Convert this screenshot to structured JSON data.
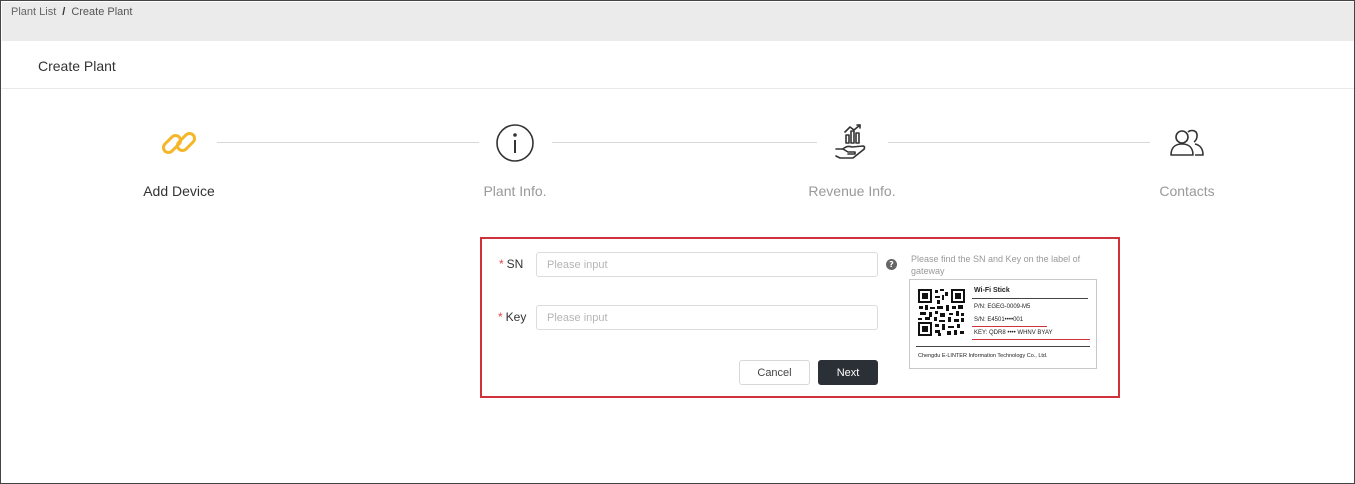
{
  "breadcrumb": {
    "items": [
      "Plant List",
      "Create Plant"
    ],
    "separator": "/"
  },
  "page": {
    "title": "Create Plant"
  },
  "steps": [
    {
      "label": "Add Device",
      "icon": "link-icon",
      "state": "active"
    },
    {
      "label": "Plant Info.",
      "icon": "info-icon",
      "state": "inactive"
    },
    {
      "label": "Revenue Info.",
      "icon": "revenue-hand-icon",
      "state": "inactive"
    },
    {
      "label": "Contacts",
      "icon": "contacts-icon",
      "state": "inactive"
    }
  ],
  "form": {
    "sn": {
      "label": "SN",
      "required_mark": "*",
      "placeholder": "Please input",
      "value": ""
    },
    "key": {
      "label": "Key",
      "required_mark": "*",
      "placeholder": "Please input",
      "value": ""
    },
    "help_icon": "question-circle-icon",
    "hint": "Please find the SN and Key on the label of gateway",
    "cancel_label": "Cancel",
    "next_label": "Next"
  },
  "device_label": {
    "title": "Wi-Fi Stick",
    "pn": "P/N:  EGEG-0009-M5",
    "sn": "S/N:  E4501••••001",
    "key": "KEY:  QDR8  ••••  WHNV BYAY",
    "company": "Chengdu E-LINTER Information Technology Co., Ltd."
  },
  "colors": {
    "accent": "#f5b729",
    "highlight_border": "#d0313b",
    "primary_button": "#2b2f36",
    "required": "#e0474d"
  }
}
